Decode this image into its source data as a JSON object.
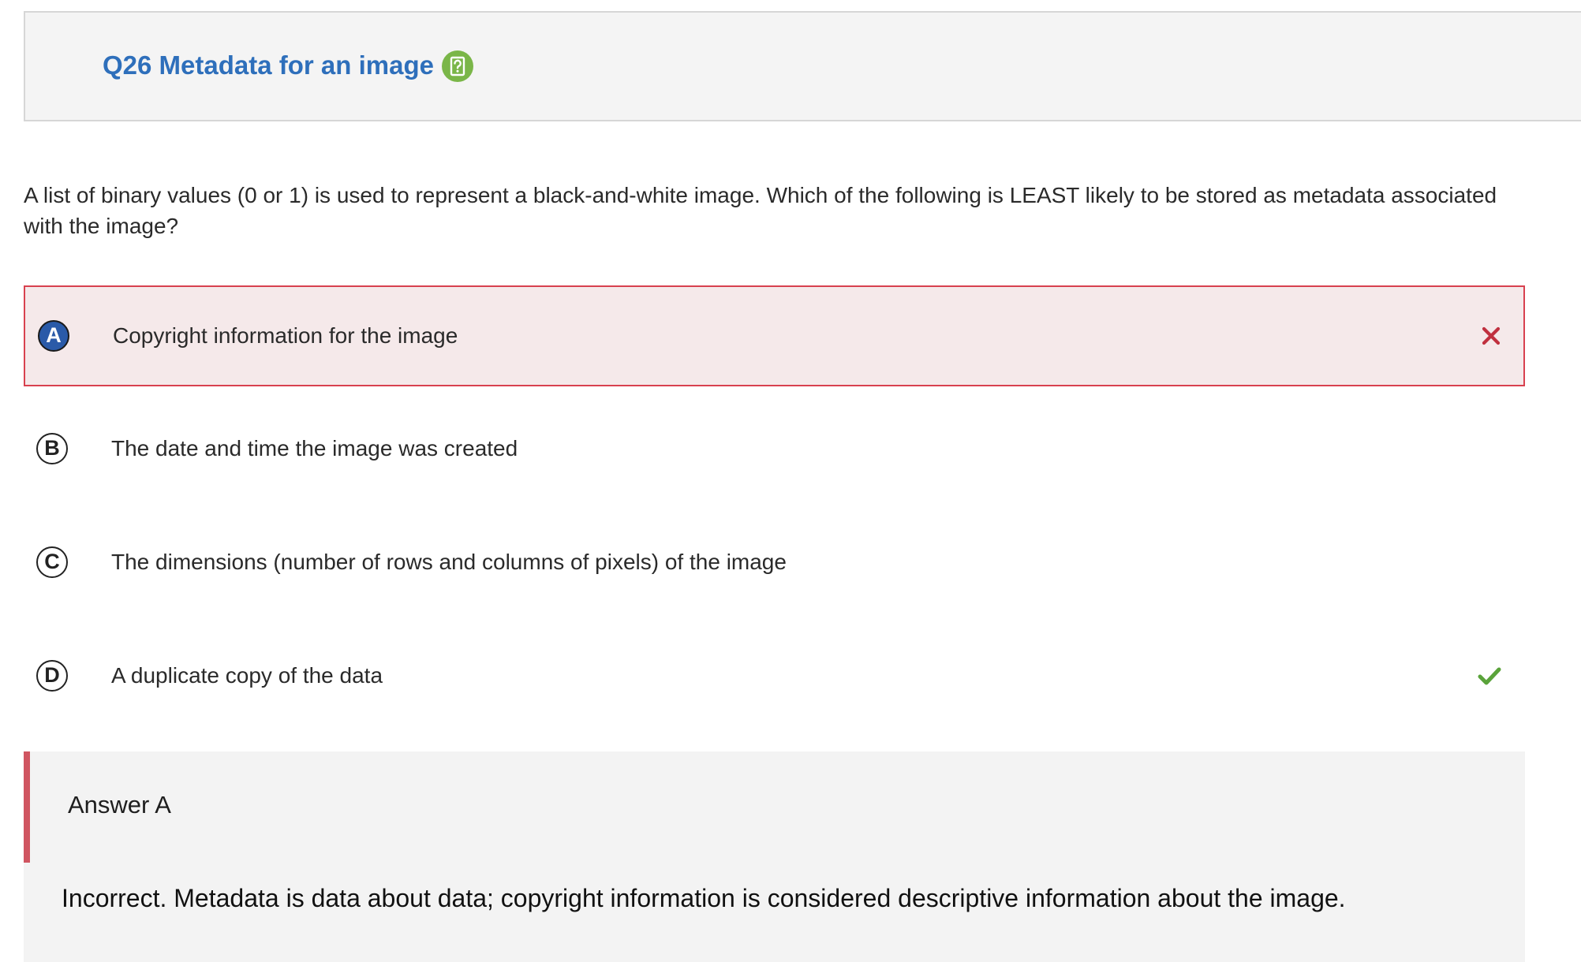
{
  "header": {
    "title": "Q26 Metadata for an image",
    "help_icon": "help-icon"
  },
  "question": {
    "text": "A list of binary values (0 or 1) is used to represent a black-and-white image. Which of the following is LEAST likely to be stored as metadata associated with the image?"
  },
  "options": [
    {
      "letter": "A",
      "text": "Copyright information for the image",
      "state": "selected-incorrect",
      "mark": "x-icon"
    },
    {
      "letter": "B",
      "text": "The date and time the image was created",
      "state": "unselected",
      "mark": ""
    },
    {
      "letter": "C",
      "text": "The dimensions (number of rows and columns of pixels) of the image",
      "state": "unselected",
      "mark": ""
    },
    {
      "letter": "D",
      "text": "A duplicate copy of the data",
      "state": "correct",
      "mark": "check-icon"
    }
  ],
  "answer": {
    "label": "Answer A",
    "explanation": "Incorrect. Metadata is data about data; copyright information is considered descriptive information about the image."
  },
  "colors": {
    "title": "#2e6fbb",
    "help_icon": "#7ab648",
    "wrong": "#c0303f",
    "correct": "#5aa33a",
    "selected_letter": "#2a5aa8",
    "answer_bar": "#d05561"
  }
}
